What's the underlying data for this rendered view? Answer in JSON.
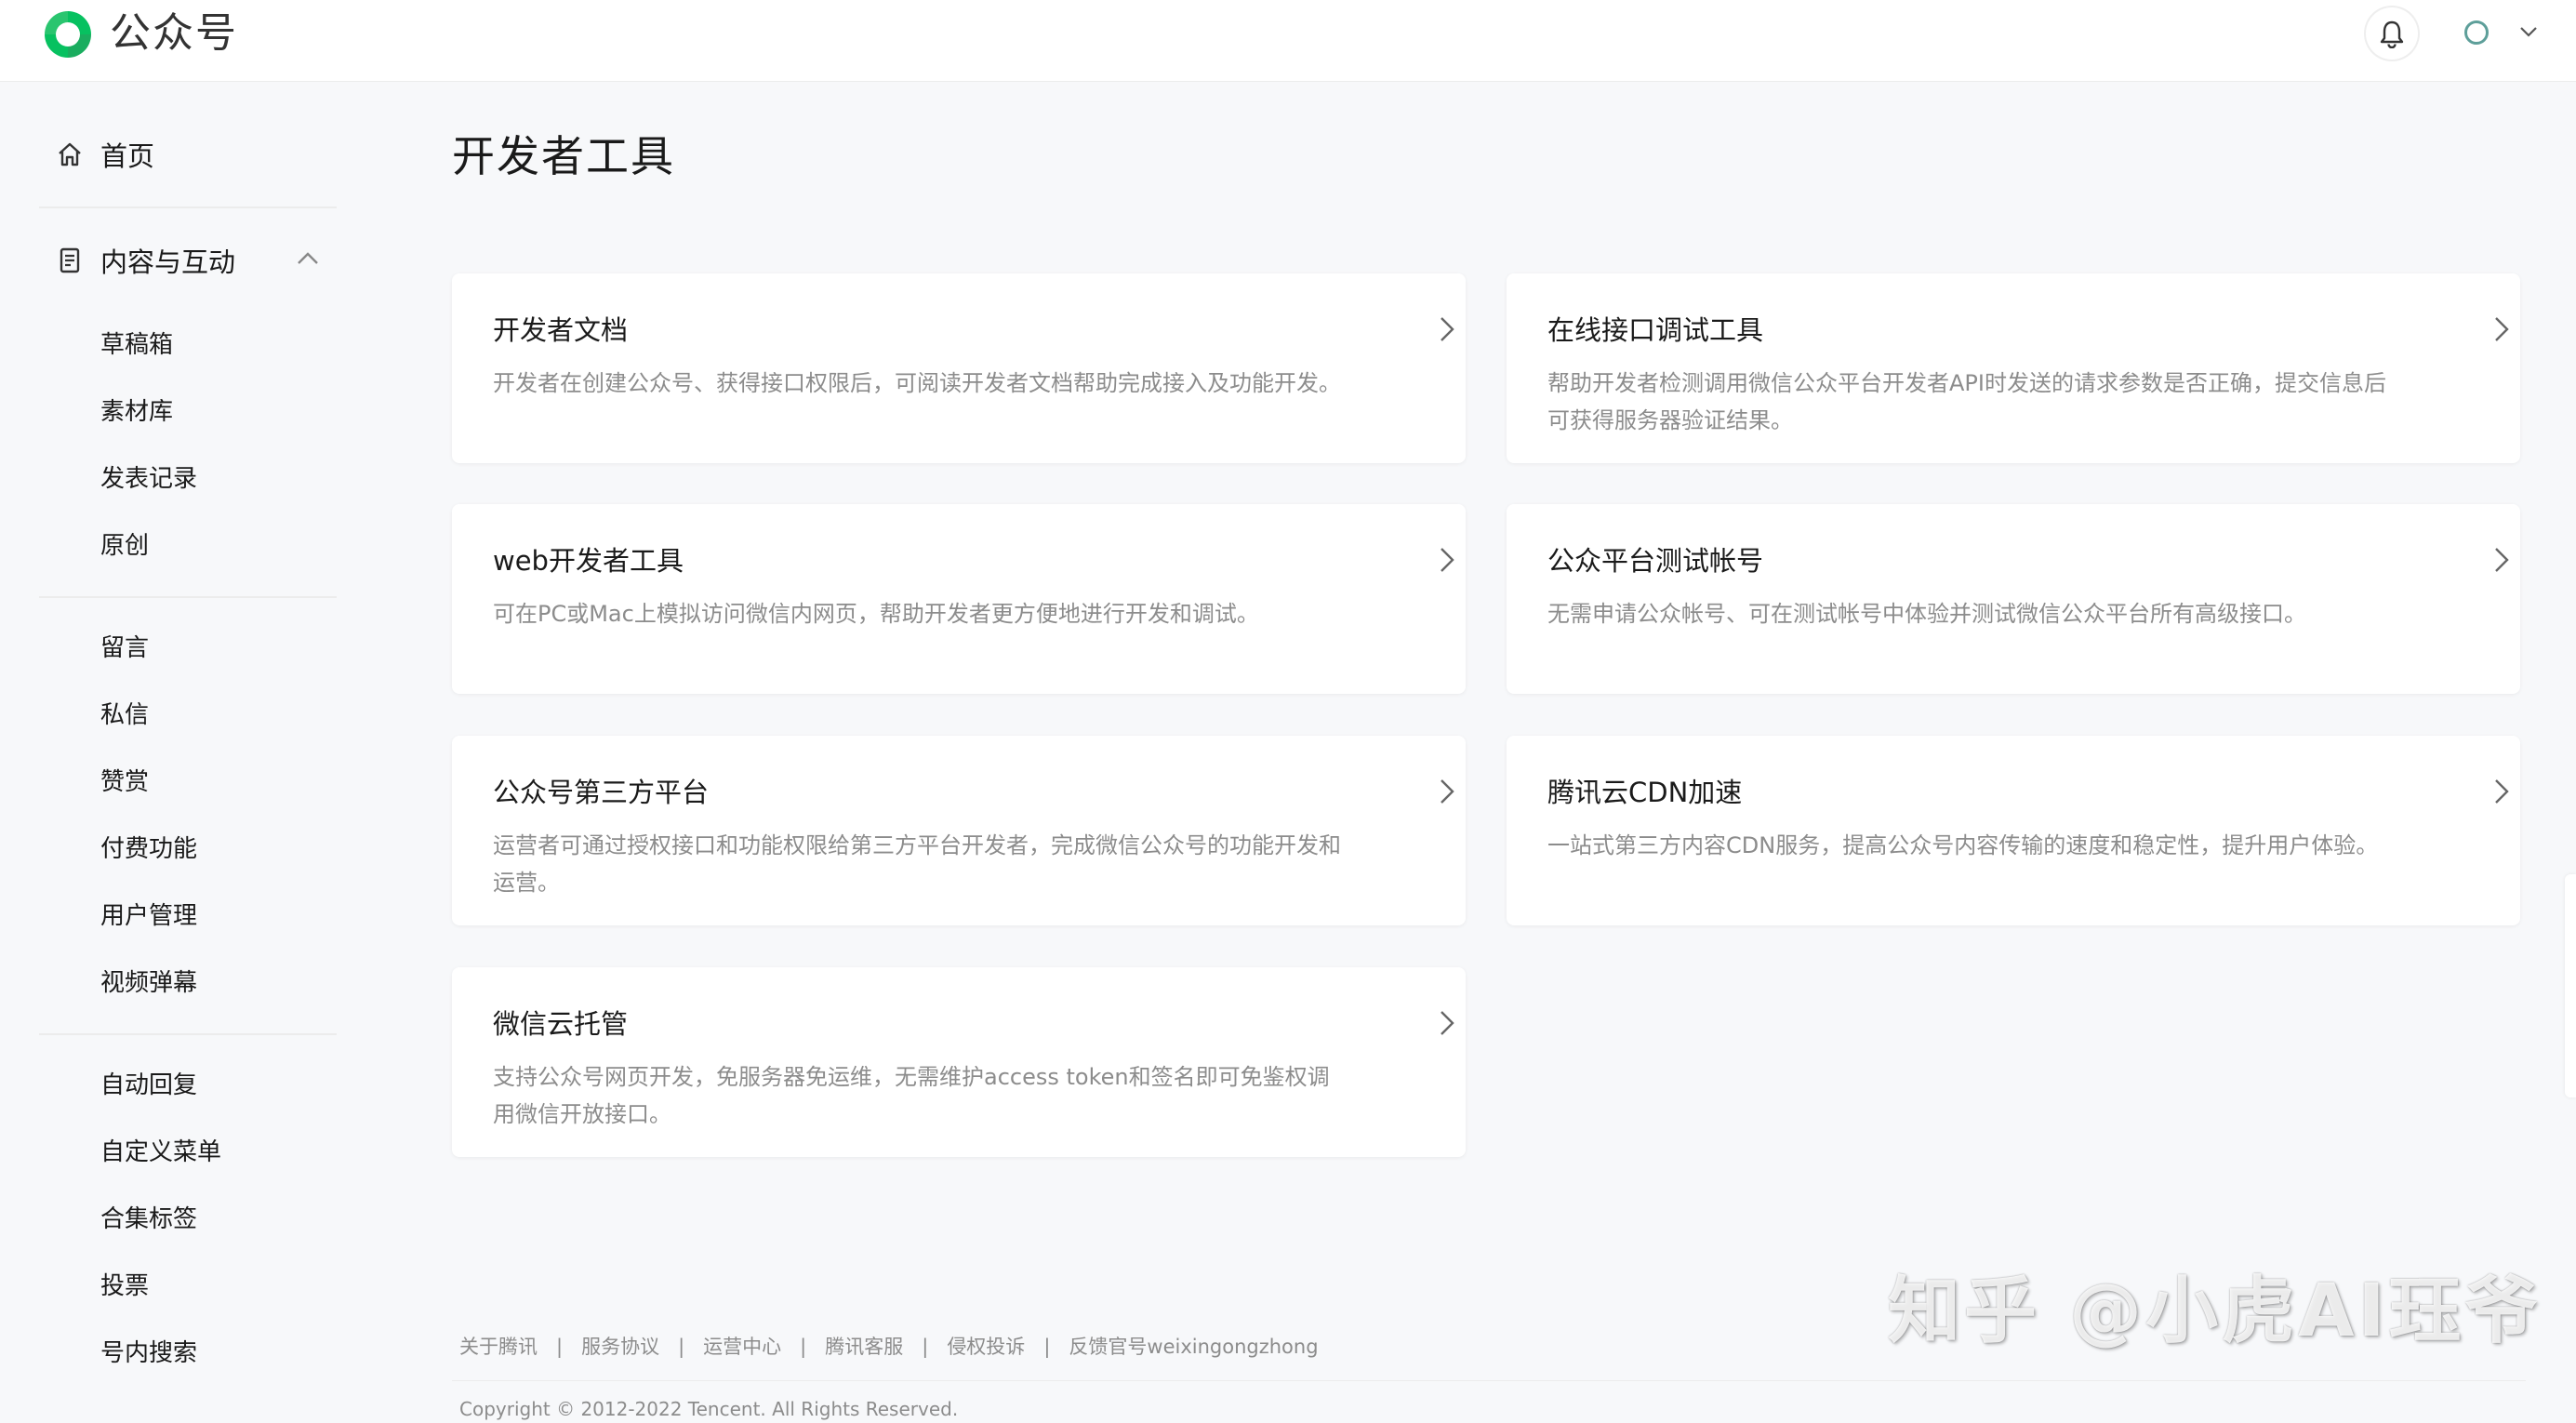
{
  "header": {
    "brand": "公众号",
    "logo_icon": "wechat-mp-logo-icon",
    "bell_icon": "bell-icon",
    "avatar_icon": "avatar-icon",
    "dropdown_icon": "chevron-down-icon"
  },
  "sidebar": {
    "home": {
      "label": "首页",
      "icon": "home-icon"
    },
    "content_group": {
      "label": "内容与互动",
      "icon": "document-icon",
      "toggle_icon": "chevron-up-icon"
    },
    "items": [
      "草稿箱",
      "素材库",
      "发表记录",
      "原创",
      "留言",
      "私信",
      "赞赏",
      "付费功能",
      "用户管理",
      "视频弹幕",
      "自动回复",
      "自定义菜单",
      "合集标签",
      "投票",
      "号内搜索"
    ]
  },
  "main": {
    "title": "开发者工具",
    "cards": [
      {
        "title": "开发者文档",
        "desc": "开发者在创建公众号、获得接口权限后，可阅读开发者文档帮助完成接入及功能开发。"
      },
      {
        "title": "在线接口调试工具",
        "desc": "帮助开发者检测调用微信公众平台开发者API时发送的请求参数是否正确，提交信息后可获得服务器验证结果。"
      },
      {
        "title": "web开发者工具",
        "desc": "可在PC或Mac上模拟访问微信内网页，帮助开发者更方便地进行开发和调试。"
      },
      {
        "title": "公众平台测试帐号",
        "desc": "无需申请公众帐号、可在测试帐号中体验并测试微信公众平台所有高级接口。"
      },
      {
        "title": "公众号第三方平台",
        "desc": "运营者可通过授权接口和功能权限给第三方平台开发者，完成微信公众号的功能开发和运营。"
      },
      {
        "title": "腾讯云CDN加速",
        "desc": "一站式第三方内容CDN服务，提高公众号内容传输的速度和稳定性，提升用户体验。"
      },
      {
        "title": "微信云托管",
        "desc": "支持公众号网页开发，免服务器免运维，无需维护access token和签名即可免鉴权调用微信开放接口。"
      }
    ],
    "arrow_icon": "chevron-right-icon"
  },
  "footer": {
    "links": [
      "关于腾讯",
      "服务协议",
      "运营中心",
      "腾讯客服",
      "侵权投诉",
      "反馈官号weixingongzhong"
    ],
    "separator": "|",
    "copyright": "Copyright © 2012-2022 Tencent. All Rights Reserved."
  },
  "watermark": "知乎 @小虎AI珏爷"
}
